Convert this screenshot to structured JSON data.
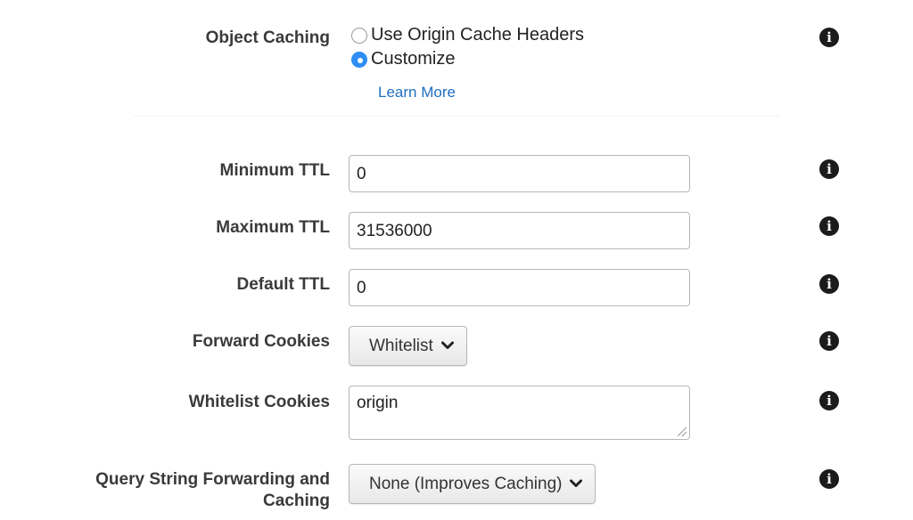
{
  "object_caching": {
    "label": "Object Caching",
    "options": [
      {
        "label": "Use Origin Cache Headers",
        "selected": false
      },
      {
        "label": "Customize",
        "selected": true
      }
    ],
    "learn_more": "Learn More"
  },
  "minimum_ttl": {
    "label": "Minimum TTL",
    "value": "0"
  },
  "maximum_ttl": {
    "label": "Maximum TTL",
    "value": "31536000"
  },
  "default_ttl": {
    "label": "Default TTL",
    "value": "0"
  },
  "forward_cookies": {
    "label": "Forward Cookies",
    "value": "Whitelist"
  },
  "whitelist_cookies": {
    "label": "Whitelist Cookies",
    "value": "origin"
  },
  "query_string": {
    "label_line1": "Query String Forwarding and",
    "label_line2": "Caching",
    "value": "None (Improves Caching)"
  },
  "info_icon_glyph": "i",
  "colors": {
    "accent": "#2e8ef4",
    "link": "#1f6fc0"
  }
}
